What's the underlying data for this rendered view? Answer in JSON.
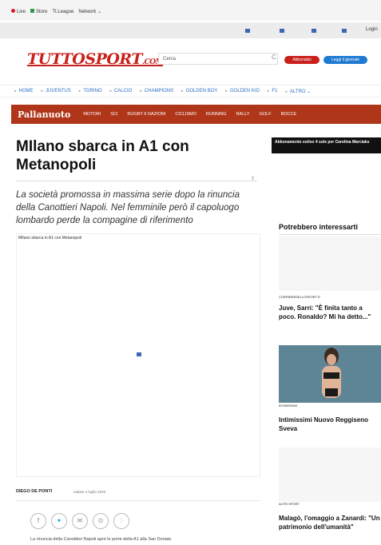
{
  "topbar": {
    "live": "Live",
    "store": "Store",
    "league": "Tt.League",
    "network": "Network ⌄",
    "login": "Login"
  },
  "header": {
    "logo": "TUTTOSPORT",
    "logo_suffix": ".COM",
    "search_placeholder": "Cerca",
    "subscribe_label": "Abbonatisi",
    "newspaper_label": "Leggi il giornale"
  },
  "nav": {
    "items": [
      "HOME",
      "JUVENTUS",
      "TORINO",
      "CALCIO",
      "CHAMPIONS",
      "GOLDEN BOY",
      "GOLDEN KID",
      "F1",
      "ALTRO ⌄"
    ]
  },
  "sportbar": {
    "title": "Pallanuoto",
    "items": [
      "Motori",
      "Sci",
      "Rugby 6 Nazioni",
      "Ciclismo",
      "Running",
      "Rally",
      "Golf",
      "Bocce"
    ]
  },
  "article": {
    "headline": "MIlano sbarca in A1 con Metanopoli",
    "subhead": "La società promossa in massima serie dopo la rinuncia della Canottieri Napoli. Nel femminile però il capoluogo lombardo perde la compagine di riferimento",
    "media_caption": "MIlano sbarca in A1 con Metanopoli",
    "author": "DIEGO DE PONTI",
    "date": "sabato 4 luglio 2020",
    "body_start": "La rinuncia della Canottieri Napoli apre le porte della A1 alla San Donato"
  },
  "sidebar": {
    "ad_text": "Abbonamento estivo 4 sole per Carolina Marciaks",
    "section_title": "Potrebbero interessarti",
    "cards": [
      {
        "source": "CORRIEREDELLOSPORT.IT",
        "title": "Juve, Sarri: \"È finita tanto a poco. Ronaldo? Mi ha detto...\""
      },
      {
        "source": "INTIMISSIMI",
        "title": "Intimissimi Nuovo Reggiseno Sveva"
      },
      {
        "source": "ALTRI SPORT",
        "title": "Malagò, l'omaggio a Zanardi: \"Un patrimonio dell'umanità\""
      }
    ]
  },
  "colors": {
    "brand_red": "#c8201b",
    "sport_bar": "#b0361a",
    "nav_blue": "#2a70c2",
    "cta_blue": "#1f7bd1"
  }
}
